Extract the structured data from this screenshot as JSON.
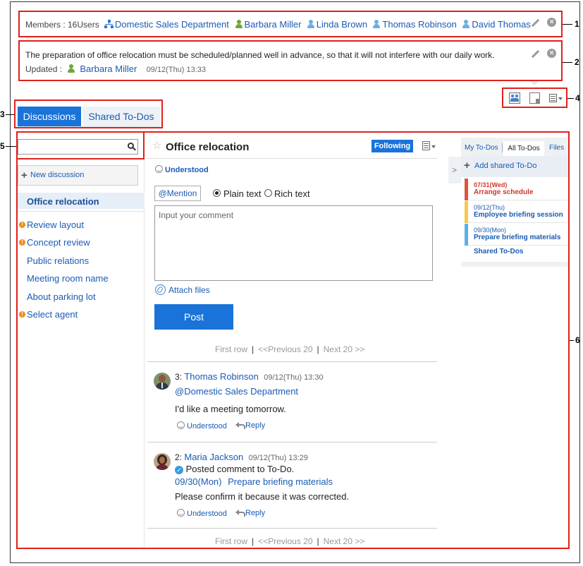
{
  "members": {
    "label": "Members : 16Users",
    "org": "Domestic Sales Department",
    "users": [
      "Barbara Miller",
      "Linda Brown",
      "Thomas Robinson",
      "David Thomas"
    ]
  },
  "description": {
    "text": "The preparation of office relocation must be scheduled/planned well in advance, so that it will not interfere with our daily work.",
    "updated_label": "Updated :",
    "updated_by": "Barbara Miller",
    "updated_at": "09/12(Thu) 13:33"
  },
  "tabs": [
    {
      "label": "Discussions",
      "active": true
    },
    {
      "label": "Shared To-Dos",
      "active": false
    }
  ],
  "sidebar": {
    "search_placeholder": "",
    "new_discussion": "New discussion",
    "items": [
      {
        "label": "Office relocation",
        "selected": true,
        "alert": false
      },
      {
        "label": "Review layout",
        "alert": true
      },
      {
        "label": "Concept review",
        "alert": true
      },
      {
        "label": "Public relations",
        "alert": false
      },
      {
        "label": "Meeting room name",
        "alert": false
      },
      {
        "label": "About parking lot",
        "alert": false
      },
      {
        "label": "Select agent",
        "alert": true
      }
    ]
  },
  "thread": {
    "title": "Office relocation",
    "following_label": "Following",
    "understood_label": "Understood",
    "mention_label": "@Mention",
    "format_plain": "Plain text",
    "format_rich": "Rich text",
    "comment_placeholder": "Input your comment",
    "attach_label": "Attach files",
    "post_label": "Post",
    "pager": {
      "first": "First row",
      "prev": "<<Previous 20",
      "next": "Next 20 >>"
    }
  },
  "comments": [
    {
      "number": "3:",
      "author": "Thomas Robinson",
      "time": "09/12(Thu) 13:30",
      "mention": "@Domestic Sales Department",
      "body": "I'd like a meeting tomorrow.",
      "understood": "Understood",
      "reply": "Reply"
    },
    {
      "number": "2:",
      "author": "Maria Jackson",
      "time": "09/12(Thu) 13:29",
      "status": "Posted comment to To-Do.",
      "todo_date": "09/30(Mon)",
      "todo_title": "Prepare briefing materials",
      "body": "Please confirm it because it was corrected.",
      "understood": "Understood",
      "reply": "Reply"
    }
  ],
  "todo_panel": {
    "tabs": [
      "My To-Dos",
      "All To-Dos",
      "Files"
    ],
    "add_label": "Add shared To-Do",
    "items": [
      {
        "date": "07/31(Wed)",
        "title": "Arrange schedule",
        "color": "#e0553a",
        "overdue": true
      },
      {
        "date": "09/12(Thu)",
        "title": "Employee briefing session",
        "color": "#f5c94a",
        "overdue": false
      },
      {
        "date": "09/30(Mon)",
        "title": "Prepare briefing materials",
        "color": "#5ab0e8",
        "overdue": false
      }
    ],
    "footer_link": "Shared To-Dos"
  },
  "callouts": [
    "1",
    "2",
    "3",
    "4",
    "5",
    "6"
  ],
  "colors": {
    "accent": "#1a73d9",
    "link": "#1a5bb4",
    "callout_red": "#e0211b"
  }
}
